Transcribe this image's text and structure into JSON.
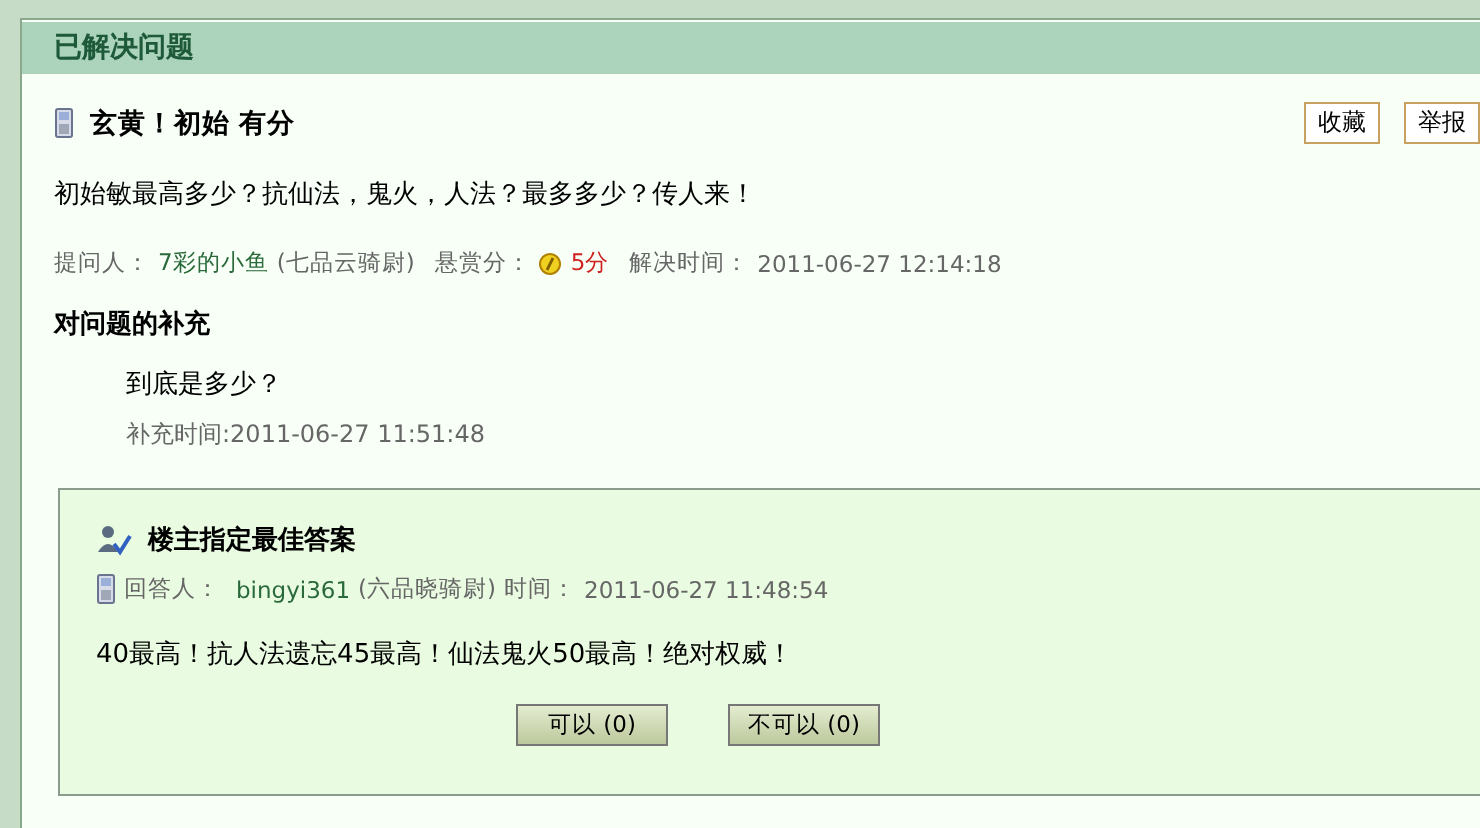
{
  "header": {
    "title": "已解决问题"
  },
  "question": {
    "title": "玄黄！初始 有分",
    "actions": [
      "收藏",
      "举报"
    ],
    "body": "初始敏最高多少？抗仙法，鬼火，人法？最多多少？传人来！",
    "meta": {
      "asker_label": "提问人：",
      "asker": "7彩的小鱼",
      "asker_rank": "(七品云骑尉)",
      "reward_label": "悬赏分：",
      "reward": "5分",
      "solved_label": "解决时间：",
      "solved_time": "2011-06-27 12:14:18"
    }
  },
  "supplement": {
    "heading": "对问题的补充",
    "text": "到底是多少？",
    "time": "补充时间:2011-06-27 11:51:48"
  },
  "best_answer": {
    "heading": "楼主指定最佳答案",
    "answerer_label": "回答人：",
    "answerer": "bingyi361",
    "answerer_rank": "(六品晓骑尉)",
    "time_label": "时间：",
    "time": "2011-06-27 11:48:54",
    "body": "40最高！抗人法遗忘45最高！仙法鬼火50最高！绝对权威！",
    "votes": [
      "可以 (0)",
      "不可以 (0)"
    ]
  }
}
